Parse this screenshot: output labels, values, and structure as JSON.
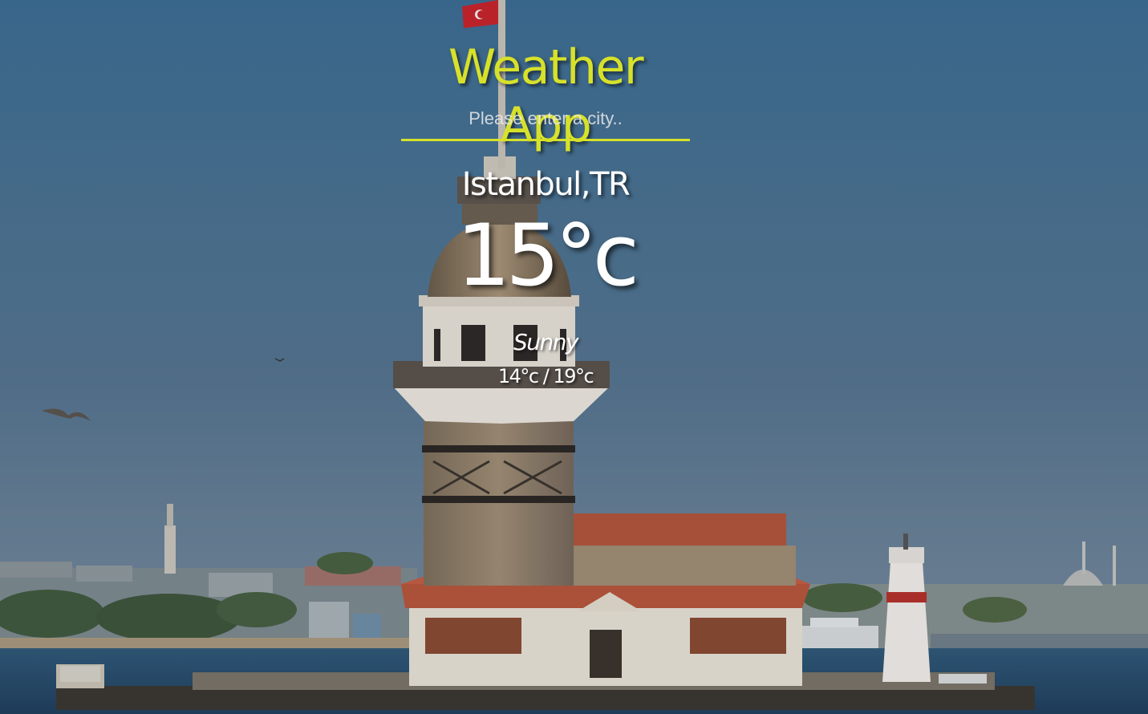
{
  "app": {
    "title": "Weather App"
  },
  "search": {
    "placeholder": "Please enter a city..",
    "value": ""
  },
  "weather": {
    "location": "Istanbul,TR",
    "temperature": "15°c",
    "condition": "Sunny",
    "hi_low": "14°c / 19°c"
  },
  "colors": {
    "accent": "#d7e12a",
    "text": "#ffffff",
    "sky": "#3f6f92",
    "sea": "#2a4f6e"
  },
  "background": {
    "icon": "maidens-tower-photo"
  }
}
